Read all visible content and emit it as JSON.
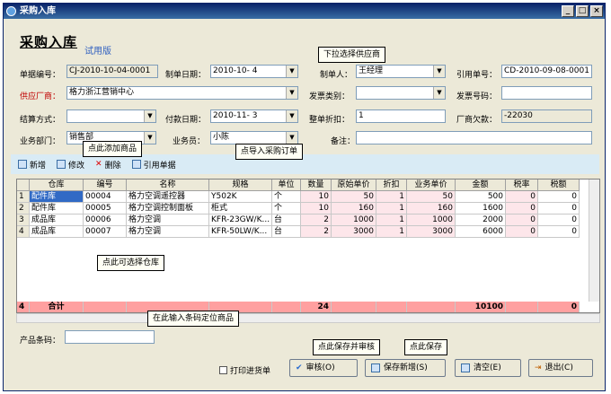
{
  "window": {
    "title": "采购入库"
  },
  "header": {
    "title": "采购入库",
    "subtitle": "试用版"
  },
  "form": {
    "doc_no_label": "单据编号：",
    "doc_no": "CJ-2010-10-04-0001",
    "date_label": "制单日期：",
    "date": "2010-10- 4",
    "maker_label": "制单人：",
    "maker": "王经理",
    "ref_label": "引用单号：",
    "ref": "CD-2010-09-08-0001",
    "supplier_label": "供应厂商：",
    "supplier": "格力浙江营销中心",
    "invoice_type_label": "发票类别：",
    "invoice_type": "",
    "invoice_no_label": "发票号码：",
    "invoice_no": "",
    "settle_label": "结算方式：",
    "settle": "",
    "pay_date_label": "付款日期：",
    "pay_date": "2010-11- 3",
    "discount_label": "整单折扣：",
    "discount": "1",
    "debt_label": "厂商欠款：",
    "debt": "-22030",
    "dept_label": "业务部门：",
    "dept": "销售部",
    "staff_label": "业务员：",
    "staff": "小陈",
    "remark_label": "备注：",
    "remark": ""
  },
  "toolbar": {
    "add": "新增",
    "edit": "修改",
    "delete": "删除",
    "cite": "引用单据"
  },
  "grid": {
    "headers": [
      "仓库",
      "编号",
      "名称",
      "规格",
      "单位",
      "数量",
      "原始单价",
      "折扣",
      "业务单价",
      "金额",
      "税率",
      "税额"
    ],
    "rows": [
      {
        "idx": "1",
        "wh": "配件库",
        "no": "00004",
        "name": "格力空调遥控器",
        "spec": "Y502K",
        "unit": "个",
        "qty": "10",
        "price": "50",
        "disc": "1",
        "bprice": "50",
        "amt": "500",
        "rate": "0",
        "tax": "0"
      },
      {
        "idx": "2",
        "wh": "配件库",
        "no": "00005",
        "name": "格力空调控制面板",
        "spec": "柜式",
        "unit": "个",
        "qty": "10",
        "price": "160",
        "disc": "1",
        "bprice": "160",
        "amt": "1600",
        "rate": "0",
        "tax": "0"
      },
      {
        "idx": "3",
        "wh": "成品库",
        "no": "00006",
        "name": "格力空调",
        "spec": "KFR-23GW/K...",
        "unit": "台",
        "qty": "2",
        "price": "1000",
        "disc": "1",
        "bprice": "1000",
        "amt": "2000",
        "rate": "0",
        "tax": "0"
      },
      {
        "idx": "4",
        "wh": "成品库",
        "no": "00007",
        "name": "格力空调",
        "spec": "KFR-50LW/K...",
        "unit": "台",
        "qty": "2",
        "price": "3000",
        "disc": "1",
        "bprice": "3000",
        "amt": "6000",
        "rate": "0",
        "tax": "0"
      }
    ],
    "sum": {
      "idx": "4",
      "label": "合计",
      "qty": "24",
      "amt": "10100",
      "tax": "0"
    }
  },
  "barcode": {
    "label": "产品条码：",
    "value": ""
  },
  "footer": {
    "print": "打印进货单",
    "audit": "审核(O)",
    "save_new": "保存新增(S)",
    "clear": "清空(E)",
    "exit": "退出(C)"
  },
  "callouts": {
    "supplier": "下拉选择供应商",
    "add": "点此添加商品",
    "cite": "点导入采购订单",
    "wh": "点此可选择仓库",
    "barcode": "在此输入条码定位商品",
    "audit": "点此保存并审核",
    "save": "点此保存"
  }
}
